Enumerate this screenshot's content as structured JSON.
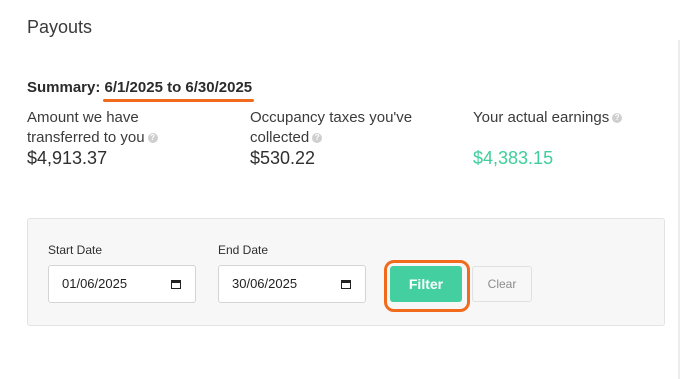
{
  "page": {
    "title": "Payouts"
  },
  "summary": {
    "prefix": "Summary:",
    "range": "6/1/2025 to 6/30/2025"
  },
  "stats": {
    "transferred": {
      "label_line1": "Amount we have",
      "label_line2": "transferred to you",
      "value": "$4,913.37"
    },
    "taxes": {
      "label_line1": "Occupancy taxes you've",
      "label_line2": "collected",
      "value": "$530.22"
    },
    "earnings": {
      "label": "Your actual earnings",
      "value": "$4,383.15"
    }
  },
  "icons": {
    "info": "info-icon",
    "calendar": "calendar-icon"
  },
  "filter": {
    "start_label": "Start Date",
    "start_value": "01/06/2025",
    "end_label": "End Date",
    "end_value": "30/06/2025",
    "filter_label": "Filter",
    "clear_label": "Clear"
  },
  "colors": {
    "accent": "#43cfa0",
    "earnings": "#3ecf9b",
    "highlight": "#f26b1d"
  }
}
